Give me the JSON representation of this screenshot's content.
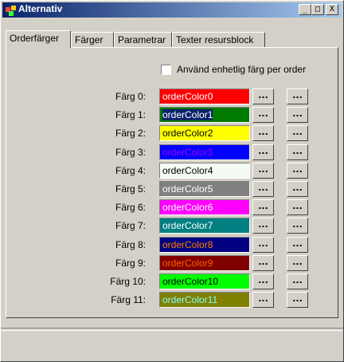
{
  "window": {
    "title": "Alternativ",
    "minimize": "_",
    "maximize": "□",
    "close": "X"
  },
  "tabs": [
    "Orderfärger",
    "Färger",
    "Parametrar",
    "Texter resursblock"
  ],
  "checkbox": {
    "label": "Använd enhetlig färg per order",
    "checked": false
  },
  "button_label": "...",
  "colors": [
    {
      "label": "Färg 0:",
      "name": "orderColor0",
      "bg": "#ff0000",
      "fg": "#ffffff"
    },
    {
      "label": "Färg 1:",
      "name": "orderColor1",
      "bg": "#007a00",
      "fg": "#ffffff"
    },
    {
      "label": "Färg 2:",
      "name": "orderColor2",
      "bg": "#ffff00",
      "fg": "#000000"
    },
    {
      "label": "Färg 3:",
      "name": "orderColor3",
      "bg": "#0000ff",
      "fg": "#a000ff"
    },
    {
      "label": "Färg 4:",
      "name": "orderColor4",
      "bg": "#f4fbf4",
      "fg": "#000000"
    },
    {
      "label": "Färg 5:",
      "name": "orderColor5",
      "bg": "#808080",
      "fg": "#ffffff"
    },
    {
      "label": "Färg 6:",
      "name": "orderColor6",
      "bg": "#ff00ff",
      "fg": "#ffffff"
    },
    {
      "label": "Färg 7:",
      "name": "orderColor7",
      "bg": "#008080",
      "fg": "#ffffff"
    },
    {
      "label": "Färg 8:",
      "name": "orderColor8",
      "bg": "#000080",
      "fg": "#ff8000"
    },
    {
      "label": "Färg 9:",
      "name": "orderColor9",
      "bg": "#800000",
      "fg": "#ff6000"
    },
    {
      "label": "Färg 10:",
      "name": "orderColor10",
      "bg": "#00ff00",
      "fg": "#000000"
    },
    {
      "label": "Färg 11:",
      "name": "orderColor11",
      "bg": "#808000",
      "fg": "#80ffff"
    }
  ]
}
